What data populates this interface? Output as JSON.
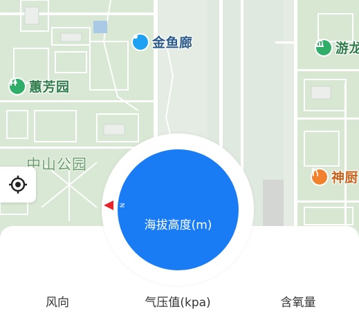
{
  "map": {
    "pois": [
      {
        "name": "金鱼廊",
        "icon": "location-pin-icon",
        "color": "#1ea1f2"
      },
      {
        "name": "蕙芳园",
        "icon": "park-icon",
        "color": "#2fae6a"
      },
      {
        "name": "游龙",
        "icon": "museum-icon",
        "color": "#2fae6a"
      },
      {
        "name": "神厨",
        "icon": "restaurant-icon",
        "color": "#f2812d"
      }
    ],
    "area_label": "中山公园"
  },
  "dial": {
    "center_label": "海拔高度(m)",
    "north_letter": "N",
    "accent_color": "#1a7cf5",
    "marker_color": "#e8242b"
  },
  "tabs": {
    "wind_direction": "风向",
    "pressure": "气压值(kpa)",
    "oxygen": "含氧量"
  }
}
